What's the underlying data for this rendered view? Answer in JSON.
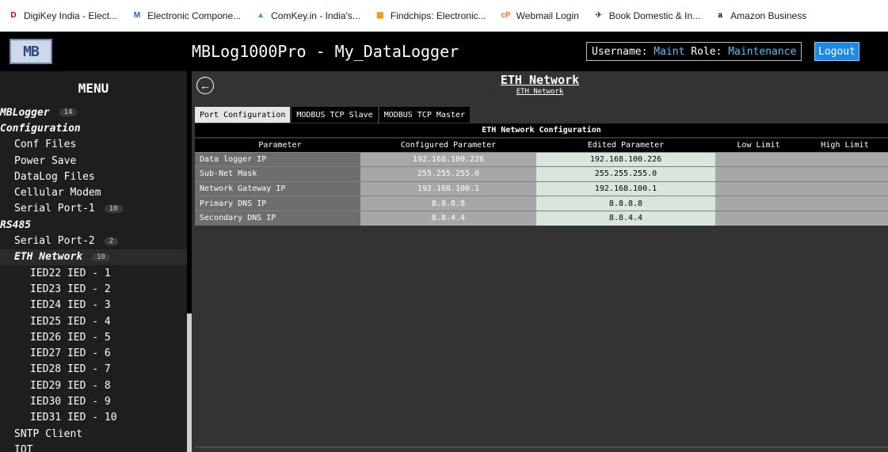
{
  "bookmarks": [
    {
      "label": "DigiKey India - Elect...",
      "icon": "digikey-icon",
      "color": "#cc0000",
      "glyph": "D"
    },
    {
      "label": "Electronic Compone...",
      "icon": "mouser-icon",
      "color": "#1565c0",
      "glyph": "M"
    },
    {
      "label": "ComKey.in - India's...",
      "icon": "comkey-icon",
      "color": "#29a3d9",
      "glyph": "▲"
    },
    {
      "label": "Findchips: Electronic...",
      "icon": "findchips-icon",
      "color": "#e69500",
      "glyph": "▦"
    },
    {
      "label": "Webmail Login",
      "icon": "cpanel-icon",
      "color": "#ff6c2c",
      "glyph": "cP"
    },
    {
      "label": "Book Domestic & In...",
      "icon": "airline-icon",
      "color": "#1e4fa8",
      "glyph": "✈"
    },
    {
      "label": "Amazon Business",
      "icon": "amazon-icon",
      "color": "#000000",
      "glyph": "a"
    }
  ],
  "header": {
    "logo_text": "MB",
    "title": "MBLog1000Pro - My_DataLogger",
    "username_label": "Username:",
    "username_value": "Maint",
    "role_label": "Role:",
    "role_value": "Maintenance",
    "logout_label": "Logout"
  },
  "sidebar": {
    "menu_title": "MENU",
    "items": [
      {
        "label": "MBLogger",
        "level": 0,
        "badge": "14"
      },
      {
        "label": "Configuration",
        "level": 0
      },
      {
        "label": "Conf Files",
        "level": 1
      },
      {
        "label": "Power Save",
        "level": 1
      },
      {
        "label": "DataLog Files",
        "level": 1
      },
      {
        "label": "Cellular Modem",
        "level": 1
      },
      {
        "label": "Serial Port-1",
        "level": 1,
        "badge": "10"
      },
      {
        "label": "RS485",
        "level": 0
      },
      {
        "label": "Serial Port-2",
        "level": 1,
        "badge": "2"
      },
      {
        "label": "ETH Network",
        "level": 1,
        "badge": "10",
        "active": true
      },
      {
        "label": "IED22 IED - 1",
        "level": 2
      },
      {
        "label": "IED23 IED - 2",
        "level": 2
      },
      {
        "label": "IED24 IED - 3",
        "level": 2
      },
      {
        "label": "IED25 IED - 4",
        "level": 2
      },
      {
        "label": "IED26 IED - 5",
        "level": 2
      },
      {
        "label": "IED27 IED - 6",
        "level": 2
      },
      {
        "label": "IED28 IED - 7",
        "level": 2
      },
      {
        "label": "IED29 IED - 8",
        "level": 2
      },
      {
        "label": "IED30 IED - 9",
        "level": 2
      },
      {
        "label": "IED31 IED - 10",
        "level": 2
      },
      {
        "label": "SNTP Client",
        "level": 1
      },
      {
        "label": "IOT",
        "level": 1
      }
    ]
  },
  "main": {
    "back_icon": "back-arrow-icon",
    "back_glyph": "←",
    "title": "ETH Network",
    "subtitle": "ETH Network",
    "tabs": [
      {
        "label": "Port Configuration",
        "active": true
      },
      {
        "label": "MODBUS TCP Slave"
      },
      {
        "label": "MODBUS TCP Master"
      }
    ],
    "table_caption": "ETH Network Configuration",
    "columns": [
      "Parameter",
      "Configured Parameter",
      "Edited Parameter",
      "Low Limit",
      "High Limit"
    ],
    "rows": [
      {
        "parameter": "Data logger IP",
        "configured": "192.168.100.226",
        "edited": "192.168.100.226",
        "low": "",
        "high": ""
      },
      {
        "parameter": "Sub-Net Mask",
        "configured": "255.255.255.0",
        "edited": "255.255.255.0",
        "low": "",
        "high": ""
      },
      {
        "parameter": "Network Gateway IP",
        "configured": "192.168.100.1",
        "edited": "192.168.100.1",
        "low": "",
        "high": ""
      },
      {
        "parameter": "Primary DNS IP",
        "configured": "8.8.8.8",
        "edited": "8.8.8.8",
        "low": "",
        "high": ""
      },
      {
        "parameter": "Secondary DNS IP",
        "configured": "8.8.4.4",
        "edited": "8.8.4.4",
        "low": "",
        "high": ""
      }
    ]
  },
  "colors": {
    "header_bg": "#000000",
    "sidebar_bg": "#1e1e1e",
    "main_bg": "#333333",
    "accent_blue": "#4fc3f7",
    "logout_bg": "#1e88e5",
    "edited_cell_bg": "#d9e6dc"
  }
}
